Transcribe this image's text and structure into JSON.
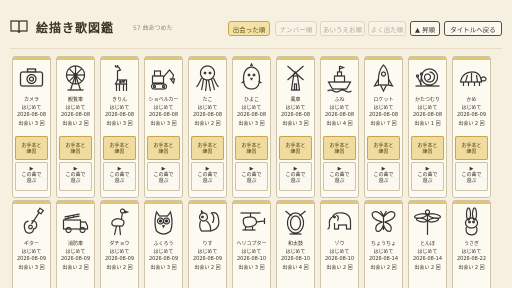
{
  "header": {
    "title": "絵描き歌図鑑",
    "count": "57 曲あつめた",
    "sort_buttons": [
      {
        "label": "出会った順",
        "active": true
      },
      {
        "label": "ナンバー順",
        "active": false
      },
      {
        "label": "あいうえお順",
        "active": false
      },
      {
        "label": "よく出た順",
        "active": false
      }
    ],
    "order_toggle": "▲ 昇順",
    "back_button": "タイトルへ戻る"
  },
  "labels": {
    "first_met": "はじめて",
    "practice_a": "お手本と",
    "practice_b": "練習",
    "play_icon": "▶",
    "play_a": "この曲で",
    "play_b": "遊ぶ"
  },
  "row1": [
    {
      "name": "カメラ",
      "date": "2026-08-08",
      "meet": "出会い 3 回",
      "icon": "camera-icon"
    },
    {
      "name": "観覧車",
      "date": "2026-08-08",
      "meet": "出会い 2 回",
      "icon": "ferris-wheel-icon"
    },
    {
      "name": "きりん",
      "date": "2026-08-08",
      "meet": "出会い 3 回",
      "icon": "giraffe-icon"
    },
    {
      "name": "ショベルカー",
      "date": "2026-08-08",
      "meet": "出会い 3 回",
      "icon": "excavator-icon"
    },
    {
      "name": "たこ",
      "date": "2026-08-08",
      "meet": "出会い 2 回",
      "icon": "octopus-icon"
    },
    {
      "name": "ひよこ",
      "date": "2026-08-08",
      "meet": "出会い 3 回",
      "icon": "chick-icon"
    },
    {
      "name": "風車",
      "date": "2026-08-08",
      "meet": "出会い 3 回",
      "icon": "windmill-icon"
    },
    {
      "name": "ふね",
      "date": "2026-08-08",
      "meet": "出会い 4 回",
      "icon": "ship-icon"
    },
    {
      "name": "ロケット",
      "date": "2026-08-08",
      "meet": "出会い 7 回",
      "icon": "rocket-icon"
    },
    {
      "name": "かたつむり",
      "date": "2026-08-08",
      "meet": "出会い 1 回",
      "icon": "snail-icon"
    },
    {
      "name": "かめ",
      "date": "2026-08-09",
      "meet": "出会い 2 回",
      "icon": "turtle-icon"
    }
  ],
  "row2": [
    {
      "name": "ギター",
      "date": "2026-08-09",
      "meet": "出会い 3 回",
      "icon": "guitar-icon"
    },
    {
      "name": "消防車",
      "date": "2026-08-09",
      "meet": "出会い 2 回",
      "icon": "fire-truck-icon"
    },
    {
      "name": "ダチョウ",
      "date": "2026-08-09",
      "meet": "出会い 2 回",
      "icon": "ostrich-icon"
    },
    {
      "name": "ふくろう",
      "date": "2026-08-09",
      "meet": "出会い 3 回",
      "icon": "owl-icon"
    },
    {
      "name": "りす",
      "date": "2026-08-09",
      "meet": "出会い 2 回",
      "icon": "squirrel-icon"
    },
    {
      "name": "ヘリコプター",
      "date": "2026-08-10",
      "meet": "出会い 3 回",
      "icon": "helicopter-icon"
    },
    {
      "name": "和太鼓",
      "date": "2026-08-10",
      "meet": "出会い 4 回",
      "icon": "taiko-drum-icon"
    },
    {
      "name": "ゾウ",
      "date": "2026-08-10",
      "meet": "出会い 2 回",
      "icon": "elephant-icon"
    },
    {
      "name": "ちょうちょ",
      "date": "2026-08-14",
      "meet": "出会い 2 回",
      "icon": "butterfly-icon"
    },
    {
      "name": "とんぼ",
      "date": "2026-08-14",
      "meet": "出会い 2 回",
      "icon": "dragonfly-icon"
    },
    {
      "name": "うさぎ",
      "date": "2026-08-22",
      "meet": "出会い 2 回",
      "icon": "rabbit-icon"
    }
  ]
}
